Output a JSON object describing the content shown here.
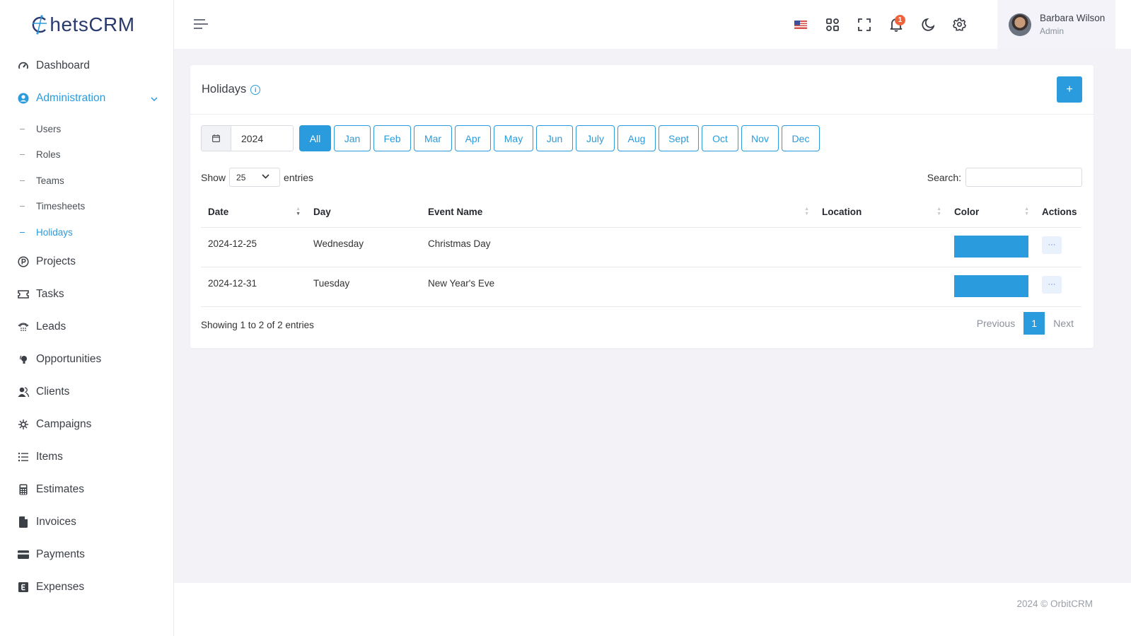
{
  "brand": {
    "name": "hetsCRM",
    "footer": "2024 © OrbitCRM"
  },
  "sidebar": {
    "items": [
      {
        "label": "Dashboard",
        "icon": "speedometer-icon"
      },
      {
        "label": "Administration",
        "icon": "user-circle-icon",
        "active": true,
        "expanded": true,
        "children": [
          {
            "label": "Users"
          },
          {
            "label": "Roles"
          },
          {
            "label": "Teams"
          },
          {
            "label": "Timesheets"
          },
          {
            "label": "Holidays",
            "active": true
          }
        ]
      },
      {
        "label": "Projects",
        "icon": "p-circle-icon"
      },
      {
        "label": "Tasks",
        "icon": "ticket-icon"
      },
      {
        "label": "Leads",
        "icon": "telephone-icon"
      },
      {
        "label": "Opportunities",
        "icon": "lightbulb-icon"
      },
      {
        "label": "Clients",
        "icon": "users-icon"
      },
      {
        "label": "Campaigns",
        "icon": "virus-icon"
      },
      {
        "label": "Items",
        "icon": "list-icon"
      },
      {
        "label": "Estimates",
        "icon": "calculator-icon"
      },
      {
        "label": "Invoices",
        "icon": "file-icon"
      },
      {
        "label": "Payments",
        "icon": "credit-card-icon"
      },
      {
        "label": "Expenses",
        "icon": "e-square-icon"
      }
    ]
  },
  "topbar": {
    "notification_count": "1",
    "user": {
      "name": "Barbara Wilson",
      "role": "Admin"
    }
  },
  "page": {
    "title": "Holidays",
    "add_label": "+",
    "year": "2024",
    "months": [
      "All",
      "Jan",
      "Feb",
      "Mar",
      "Apr",
      "May",
      "Jun",
      "July",
      "Aug",
      "Sept",
      "Oct",
      "Nov",
      "Dec"
    ],
    "active_month": "All",
    "show_label": "Show",
    "entries_label": "entries",
    "page_size": "25",
    "search_label": "Search:",
    "search_value": "",
    "columns": [
      "Date",
      "Day",
      "Event Name",
      "Location",
      "Color",
      "Actions"
    ],
    "rows": [
      {
        "date": "2024-12-25",
        "day": "Wednesday",
        "event": "Christmas Day",
        "location": "",
        "color": "#2a9bdc",
        "action": "···"
      },
      {
        "date": "2024-12-31",
        "day": "Tuesday",
        "event": "New Year's Eve",
        "location": "",
        "color": "#2a9bdc",
        "action": "···"
      }
    ],
    "info": "Showing 1 to 2 of 2 entries",
    "pagination": {
      "previous": "Previous",
      "current": "1",
      "next": "Next"
    }
  }
}
